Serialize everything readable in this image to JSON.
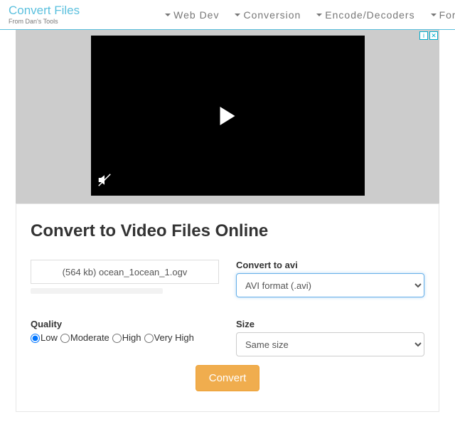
{
  "brand": {
    "title": "Convert Files",
    "subtitle": "From Dan's Tools"
  },
  "nav": {
    "items": [
      "Web Dev",
      "Conversion",
      "Encode/Decoders",
      "Forma"
    ]
  },
  "ad": {
    "info": "i",
    "close": "✕"
  },
  "page": {
    "heading": "Convert to Video Files Online"
  },
  "file": {
    "display": "(564 kb) ocean_1ocean_1.ogv"
  },
  "format": {
    "label": "Convert to avi",
    "selected": "AVI format (.avi)"
  },
  "quality": {
    "label": "Quality",
    "options": [
      "Low",
      "Moderate",
      "High",
      "Very High"
    ],
    "selected": "Low"
  },
  "size": {
    "label": "Size",
    "selected": "Same size"
  },
  "convert": {
    "label": "Convert"
  }
}
